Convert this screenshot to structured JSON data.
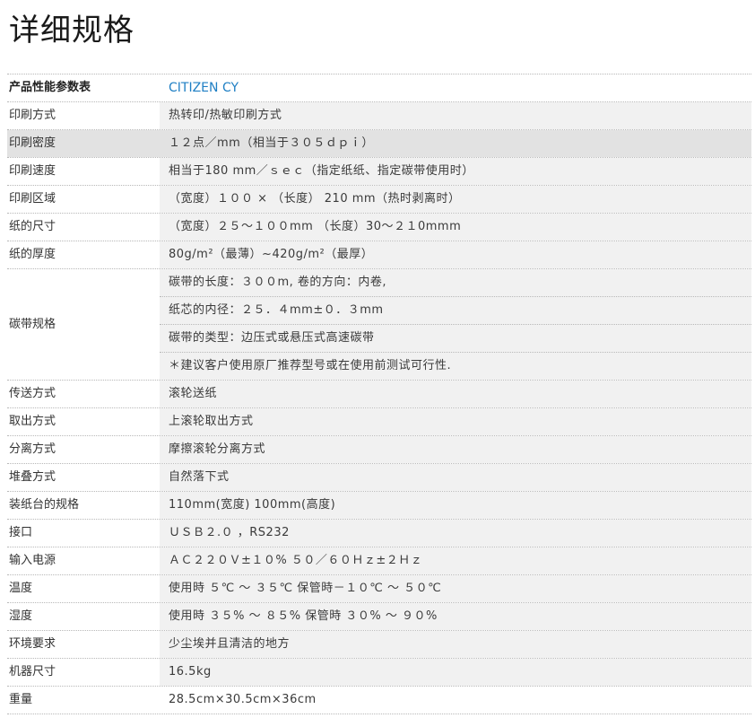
{
  "title": "详细规格",
  "header": {
    "key": "产品性能参数表",
    "value": "CITIZEN CY"
  },
  "rows": [
    {
      "key": "印刷方式",
      "value": "热转印/热敏印刷方式"
    },
    {
      "key": "印刷密度",
      "value": "１２点／mm（相当于３０５ｄｐｉ）"
    },
    {
      "key": "印刷速度",
      "value": "相当于180 mm／ｓｅｃ（指定纸纸、指定碳带使用时）"
    },
    {
      "key": "印刷区域",
      "value": "（宽度）１００ × （长度） 210 mm（热时剥离时）"
    },
    {
      "key": "纸的尺寸",
      "value": "（宽度）２５～１００mm （长度）30～２１0mmm"
    },
    {
      "key": "纸的厚度",
      "value": "80g/m²（最薄）~420g/m²（最厚）"
    }
  ],
  "ribbon": {
    "key": "碳带规格",
    "items": [
      "碳带的长度：３００m, 卷的方向：内卷,",
      "纸芯的内径：２５．４mm±０．３mm",
      "碳带的类型：边压式或悬压式高速碳带",
      "＊建议客户使用原厂推荐型号或在使用前测试可行性."
    ]
  },
  "rows2": [
    {
      "key": "传送方式",
      "value": "滚轮送纸"
    },
    {
      "key": "取出方式",
      "value": "上滚轮取出方式"
    },
    {
      "key": "分离方式",
      "value": "摩擦滚轮分离方式"
    },
    {
      "key": "堆叠方式",
      "value": "自然落下式"
    },
    {
      "key": "装纸台的规格",
      "value": "110mm(宽度) 100mm(高度)"
    },
    {
      "key": "接口",
      "value": "ＵＳＢ２.０ ，RS232"
    },
    {
      "key": "输入电源",
      "value": "ＡＣ２２０Ｖ±１０% ５０／６０Ｈｚ±２Ｈｚ"
    },
    {
      "key": "温度",
      "value": "使用時 ５℃ ～ ３５℃ 保管時－１０℃ ～ ５０℃"
    },
    {
      "key": "湿度",
      "value": "使用時 ３５% ～ ８５% 保管時 ３０% ～ ９０%"
    },
    {
      "key": "环境要求",
      "value": "少尘埃并且清洁的地方"
    },
    {
      "key": "机器尺寸",
      "value": "16.5kg"
    },
    {
      "key": "重量",
      "value": "28.5cm×30.5cm×36cm"
    }
  ]
}
